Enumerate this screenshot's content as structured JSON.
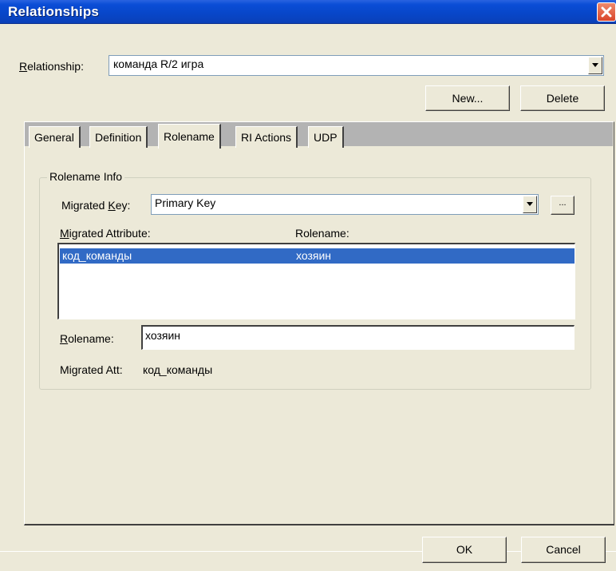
{
  "window": {
    "title": "Relationships",
    "close_icon": "close-icon"
  },
  "relationship": {
    "label_prefix": "",
    "label_access": "R",
    "label_rest": "elationship:",
    "value": "команда R/2 игра"
  },
  "toolbar": {
    "new_label": "New...",
    "delete_label": "Delete"
  },
  "tabs": [
    {
      "label": "General"
    },
    {
      "label": "Definition"
    },
    {
      "label": "Rolename",
      "active": true
    },
    {
      "label": "RI Actions"
    },
    {
      "label": "UDP"
    }
  ],
  "rolename_info": {
    "group_title": "Rolename Info",
    "migrated_key_label_pre": "Migrated ",
    "migrated_key_label_access": "K",
    "migrated_key_label_post": "ey:",
    "migrated_key_value": "Primary Key",
    "ellipsis_label": "...",
    "col_migrated_attribute_access": "M",
    "col_migrated_attribute_rest": "igrated Attribute:",
    "col_rolename": "Rolename:",
    "rows": [
      {
        "attribute": "код_команды",
        "rolename": "хозяин",
        "selected": true
      }
    ],
    "rolename_label_access": "R",
    "rolename_label_rest": "olename:",
    "rolename_value": "хозяин",
    "migrated_att_label": "Migrated Att:",
    "migrated_att_value": "код_команды"
  },
  "footer": {
    "ok_label": "OK",
    "cancel_label": "Cancel"
  },
  "colors": {
    "titlebar": "#0A4DD6",
    "dialog_bg": "#ECE9D8",
    "selection": "#316AC5",
    "close_button": "#D9452A"
  }
}
